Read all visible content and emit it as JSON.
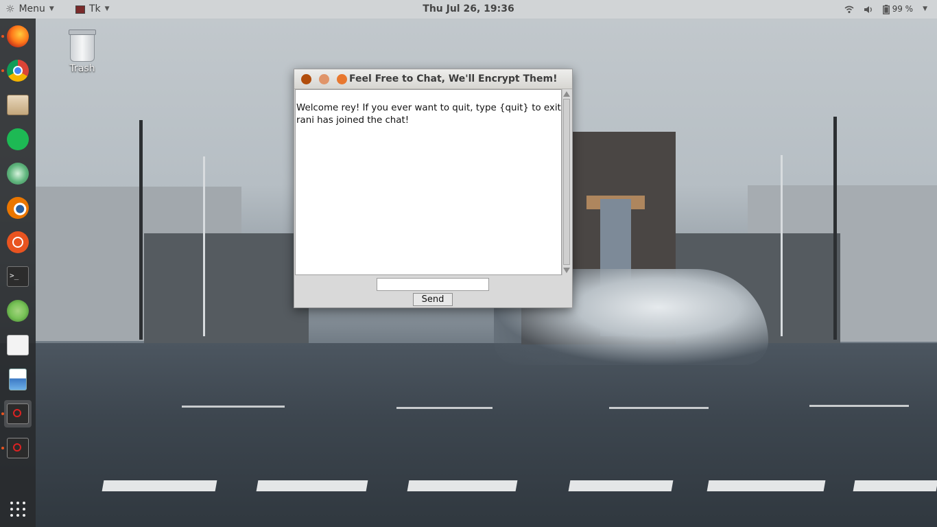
{
  "top_panel": {
    "menu_label": "Menu",
    "menu_icon": "ubuntu-logo-icon",
    "tk_label": "Tk",
    "clock": "Thu Jul 26, 19:36",
    "battery": "99 %",
    "tray_icons": [
      "wifi-icon",
      "volume-icon",
      "battery-icon"
    ]
  },
  "launcher": {
    "items": [
      {
        "name": "firefox",
        "color": "#e66000"
      },
      {
        "name": "chrome",
        "color": "#4285f4"
      },
      {
        "name": "files",
        "color": "#c9a97a"
      },
      {
        "name": "spotify",
        "color": "#1db954"
      },
      {
        "name": "atom",
        "color": "#5fb57d"
      },
      {
        "name": "blender",
        "color": "#ea7600"
      },
      {
        "name": "ubuntu-software",
        "color": "#e95420"
      },
      {
        "name": "terminal",
        "color": "#2c2c2c"
      },
      {
        "name": "android-studio",
        "color": "#78c257"
      },
      {
        "name": "document-viewer",
        "color": "#e8e8e8"
      },
      {
        "name": "image-viewer",
        "color": "#ffffff"
      },
      {
        "name": "tk-app-1",
        "color": "#333333"
      },
      {
        "name": "tk-app-2",
        "color": "#333333"
      }
    ],
    "show_apps": "show-applications-icon"
  },
  "desktop": {
    "trash_label": "Trash"
  },
  "chat_window": {
    "title": "Feel Free to Chat, We'll Encrypt Them!",
    "messages": [
      "Welcome rey! If you ever want to quit, type {quit} to exit.",
      "rani has joined the chat!"
    ],
    "input_value": "",
    "send_label": "Send"
  }
}
